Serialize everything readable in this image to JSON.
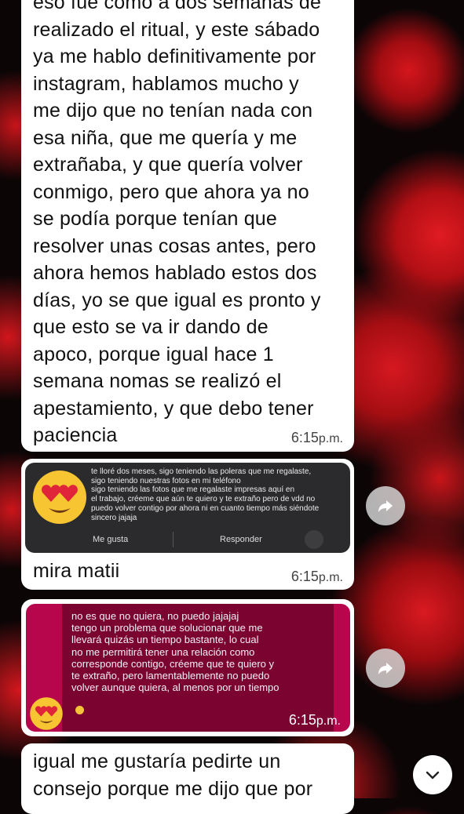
{
  "messages": [
    {
      "lines": [
        "eso fue como a dos semanas de",
        "realizado el ritual, y este sábado",
        "ya me hablo definitivamente por",
        "instagram, hablamos mucho y",
        "me dijo que no tenían nada con",
        "esa niña, que me quería y me",
        "extrañaba, y que quería volver",
        "conmigo, pero que ahora ya no",
        "se podía porque tenían que",
        "resolver unas cosas antes, pero",
        "ahora hemos hablado estos dos",
        "días, yo se que igual es pronto y",
        "que esto se va ir dando de",
        "apoco, porque igual hace 1",
        "semana nomas se realizó el",
        "apestamiento,  y que debo tener",
        "paciencia"
      ],
      "time": "6:15",
      "time_suffix": "p.m."
    },
    {
      "image": {
        "lines": [
          "te lloré dos meses, sigo teniendo las poleras que me regalaste,",
          "sigo teniendo nuestras fotos en mi teléfono",
          "sigo teniendo las fotos que me regalaste impresas aquí en",
          "el trabajo, créeme que aún te quiero y te extraño pero de vdd no",
          "puedo volver contigo por ahora ni en cuanto tiempo más siéndote",
          "sincero jajaja"
        ],
        "like_label": "Me gusta",
        "reply_label": "Responder"
      },
      "caption": "mira matii",
      "time": "6:15",
      "time_suffix": "p.m."
    },
    {
      "image": {
        "lines": [
          "no es que no quiera, no puedo jajajaj",
          "tengo un problema que solucionar que me",
          "llevará quizás un tiempo bastante, lo cual",
          "no me permitirá tener una relación como",
          "corresponde contigo, créeme que te quiero y",
          "te extraño, pero lamentablemente no puedo",
          "volver aunque quiera, al menos por un tiempo"
        ]
      },
      "time": "6:15",
      "time_suffix": "p.m."
    },
    {
      "lines": [
        "igual me gustaría pedirte un",
        "consejo porque me dijo que por"
      ]
    }
  ],
  "colors": {
    "bubble": "#ffffff",
    "image_card": "#2b2b2d",
    "pink_card": "#b8064c",
    "background_flower": "#d4161c"
  },
  "icons": {
    "forward": "forward-arrow-icon",
    "scroll_down": "chevron-down-icon",
    "emoji": "heart-eyes-emoji"
  }
}
